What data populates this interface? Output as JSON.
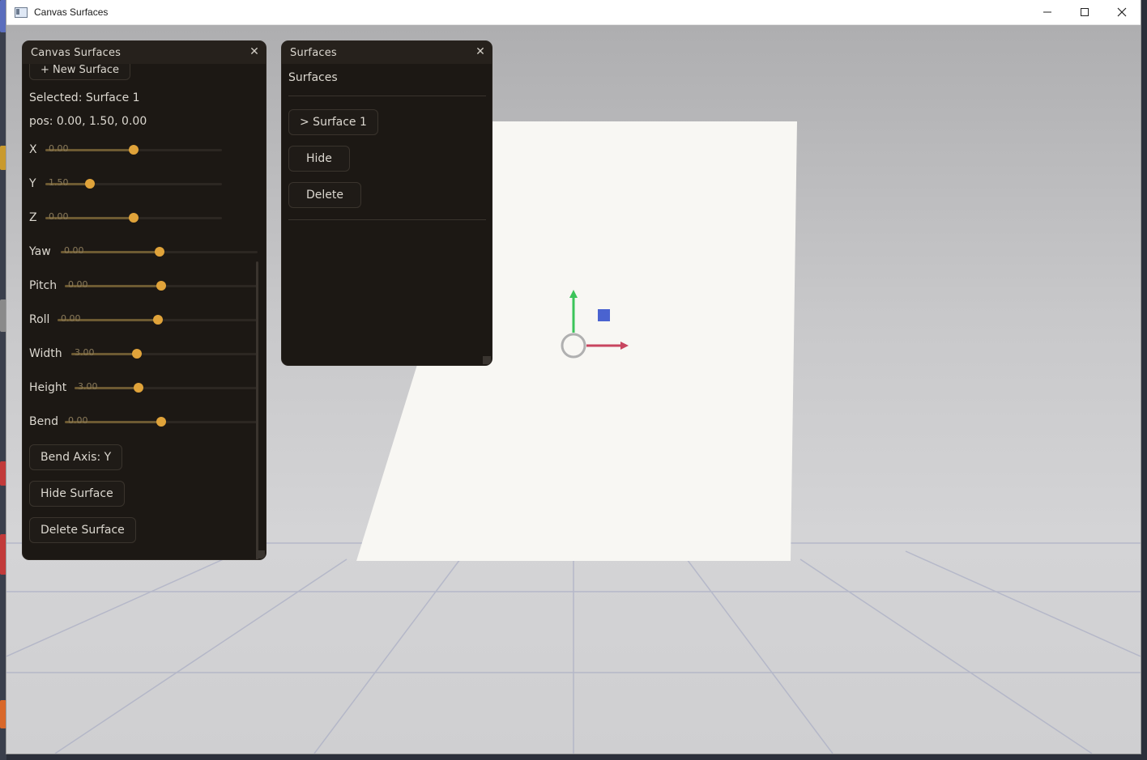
{
  "window": {
    "title": "Canvas Surfaces",
    "minimize_icon": "minimize-icon",
    "maximize_icon": "maximize-icon",
    "close_icon": "close-icon"
  },
  "main_panel": {
    "title": "Canvas Surfaces",
    "new_surface_label": "+ New Surface",
    "selected_text": "Selected: Surface 1",
    "pos_text": "pos: 0.00, 1.50, 0.00",
    "sliders": [
      {
        "label": "X",
        "value": "0.00",
        "fraction": 0.5
      },
      {
        "label": "Y",
        "value": "1.50",
        "fraction": 0.25
      },
      {
        "label": "Z",
        "value": "0.00",
        "fraction": 0.5
      },
      {
        "label": "Yaw",
        "value": "0.00",
        "fraction": 0.5
      },
      {
        "label": "Pitch",
        "value": "0.00",
        "fraction": 0.5
      },
      {
        "label": "Roll",
        "value": "0.00",
        "fraction": 0.5
      },
      {
        "label": "Width",
        "value": "3.00",
        "fraction": 0.35
      },
      {
        "label": "Height",
        "value": "3.00",
        "fraction": 0.35
      },
      {
        "label": "Bend",
        "value": "0.00",
        "fraction": 0.5
      }
    ],
    "bend_axis_label": "Bend Axis: Y",
    "hide_surface_label": "Hide Surface",
    "delete_surface_label": "Delete Surface"
  },
  "surfaces_panel": {
    "title": "Surfaces",
    "heading": "Surfaces",
    "surface_item_label": "> Surface 1",
    "hide_label": "Hide",
    "delete_label": "Delete"
  },
  "gizmo": {
    "y_axis_color": "#3cc45a",
    "x_axis_color": "#c8455f",
    "z_handle_color": "#4a63d0",
    "center_color": "#b0b0b0"
  },
  "colors": {
    "panel_bg": "#1c1814",
    "slider_knob": "#e0a33a",
    "surface_fill": "#f8f7f3"
  }
}
